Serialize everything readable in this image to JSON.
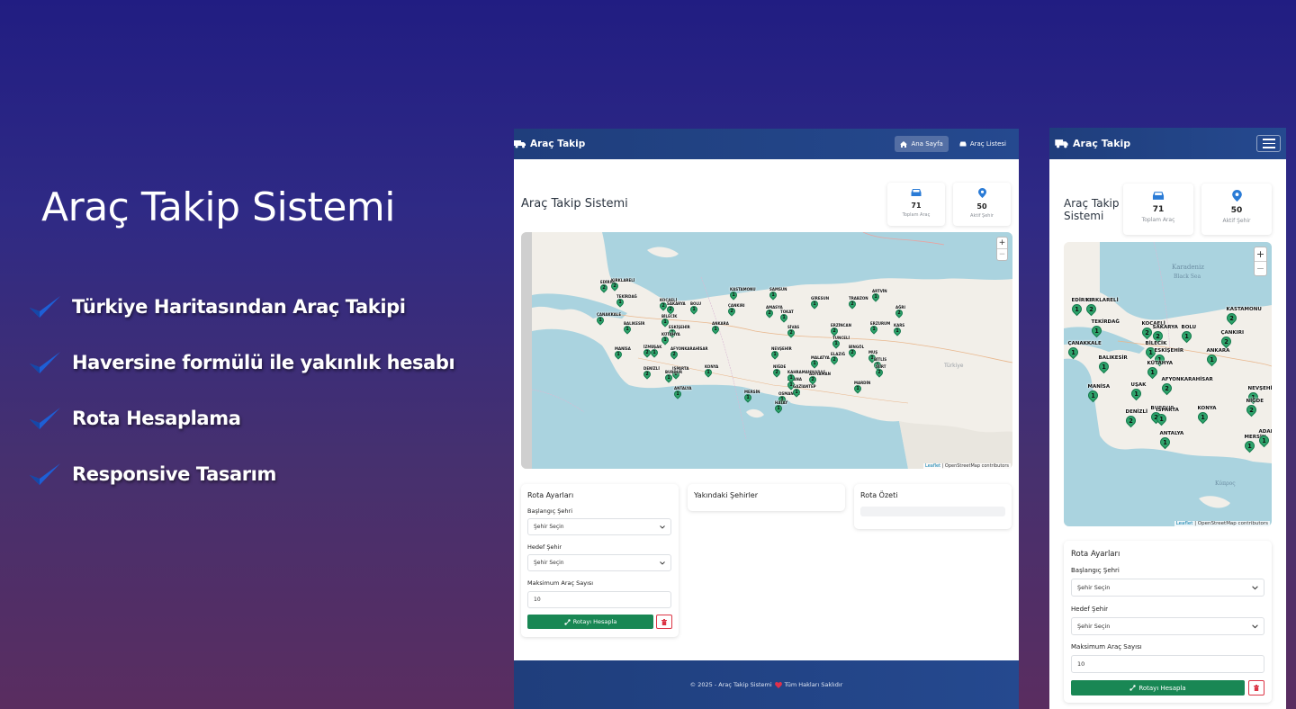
{
  "promo": {
    "title": "Araç Takip Sistemi",
    "features": [
      "Türkiye Haritasından Araç Takipi",
      "Haversine formülü ile yakınlık hesabı",
      "Rota Hesaplama",
      "Responsive Tasarım"
    ]
  },
  "app": {
    "brand": "Araç Takip",
    "nav": {
      "home": "Ana Sayfa",
      "list": "Araç Listesi"
    },
    "page_title": "Araç Takip Sistemi",
    "mobile_page_title_line1": "Araç Takip",
    "mobile_page_title_line2": "Sistemi",
    "stats": {
      "vehicles": {
        "value": "71",
        "label": "Toplam Araç"
      },
      "cities": {
        "value": "50",
        "label": "Aktif Şehir"
      }
    },
    "map": {
      "zoom_in": "+",
      "zoom_out": "−",
      "attribution_leaflet": "Leaflet",
      "attribution_osm": "| OpenStreetMap contributors",
      "sea_label": "Karadeniz",
      "sea_label2": "Black Sea"
    },
    "route": {
      "title": "Rota Ayarları",
      "start_label": "Başlangıç Şehri",
      "start_value": "Şehir Seçin",
      "target_label": "Hedef Şehir",
      "target_value": "Şehir Seçin",
      "max_label": "Maksimum Araç Sayısı",
      "max_value": "10",
      "calc_button": "Rotayı Hesapla"
    },
    "nearby_title": "Yakındaki Şehirler",
    "summary_title": "Rota Özeti",
    "footer_left": "© 2025 - Araç Takip Sistemi",
    "footer_right": "Tüm Hakları Saklıdır"
  },
  "desktop_cities": [
    {
      "n": "EDİRNE",
      "c": "2"
    },
    {
      "n": "KIRKLARELİ",
      "c": "2"
    },
    {
      "n": "TEKİRDAĞ",
      "c": "1"
    },
    {
      "n": "ÇANAKKALE",
      "c": "1"
    },
    {
      "n": "BALIKESİR",
      "c": "1"
    },
    {
      "n": "MANİSA",
      "c": "1"
    },
    {
      "n": "İZMİR",
      "c": "2"
    },
    {
      "n": "DENİZLİ",
      "c": "2"
    },
    {
      "n": "KOCAELİ",
      "c": "2"
    },
    {
      "n": "SAKARYA",
      "c": "2"
    },
    {
      "n": "BOLU",
      "c": "1"
    },
    {
      "n": "BİLECİK",
      "c": "1"
    },
    {
      "n": "ESKİŞEHİR",
      "c": "1"
    },
    {
      "n": "KÜTAHYA",
      "c": "1"
    },
    {
      "n": "UŞAK",
      "c": "1"
    },
    {
      "n": "AFYONKARAHİSAR",
      "c": "2"
    },
    {
      "n": "ISPARTA",
      "c": "2"
    },
    {
      "n": "BURDUR",
      "c": "1"
    },
    {
      "n": "ANTALYA",
      "c": "1"
    },
    {
      "n": "KONYA",
      "c": "1"
    },
    {
      "n": "ANKARA",
      "c": "1"
    },
    {
      "n": "KASTAMONU",
      "c": "1"
    },
    {
      "n": "ÇANKIRI",
      "c": "2"
    },
    {
      "n": "SAMSUN",
      "c": "1"
    },
    {
      "n": "AMASYA",
      "c": "2"
    },
    {
      "n": "TOKAT",
      "c": "1"
    },
    {
      "n": "SİVAS",
      "c": "2"
    },
    {
      "n": "NEVŞEHİR",
      "c": "1"
    },
    {
      "n": "NİĞDE",
      "c": "2"
    },
    {
      "n": "ADANA",
      "c": "1"
    },
    {
      "n": "MERSİN",
      "c": "1"
    },
    {
      "n": "OSMANİYE",
      "c": "1"
    },
    {
      "n": "HATAY",
      "c": "1"
    },
    {
      "n": "GAZİANTEP",
      "c": "1"
    },
    {
      "n": "KAHRAMANMARAŞ",
      "c": "1"
    },
    {
      "n": "ADIYAMAN",
      "c": "2"
    },
    {
      "n": "MALATYA",
      "c": "1"
    },
    {
      "n": "ELAZIĞ",
      "c": "2"
    },
    {
      "n": "TUNCELİ",
      "c": "1"
    },
    {
      "n": "BİNGÖL",
      "c": "2"
    },
    {
      "n": "MUŞ",
      "c": "1"
    },
    {
      "n": "BİTLİS",
      "c": "1"
    },
    {
      "n": "SİİRT",
      "c": "2"
    },
    {
      "n": "MARDİN",
      "c": "1"
    },
    {
      "n": "ERZİNCAN",
      "c": "2"
    },
    {
      "n": "ERZURUM",
      "c": "1"
    },
    {
      "n": "GİRESUN",
      "c": "1"
    },
    {
      "n": "TRABZON",
      "c": "2"
    },
    {
      "n": "ARTVİN",
      "c": "1"
    },
    {
      "n": "KARS",
      "c": "1"
    },
    {
      "n": "AĞRI",
      "c": "2"
    }
  ],
  "mobile_cities": [
    {
      "n": "EDİRNE",
      "c": "1"
    },
    {
      "n": "KIRKLARELİ",
      "c": "2"
    },
    {
      "n": "TEKİRDAĞ",
      "c": "1"
    },
    {
      "n": "ÇANAKKALE",
      "c": "1"
    },
    {
      "n": "BALIKESİR",
      "c": "1"
    },
    {
      "n": "MANİSA",
      "c": "1"
    },
    {
      "n": "UŞAK",
      "c": "1"
    },
    {
      "n": "DENİZLİ",
      "c": "2"
    },
    {
      "n": "BURDUR",
      "c": "2"
    },
    {
      "n": "ISPARTA",
      "c": "1"
    },
    {
      "n": "ANTALYA",
      "c": "1"
    },
    {
      "n": "KONYA",
      "c": "1"
    },
    {
      "n": "KOCAELİ",
      "c": "2"
    },
    {
      "n": "SAKARYA",
      "c": "2"
    },
    {
      "n": "BOLU",
      "c": "1"
    },
    {
      "n": "BİLECİK",
      "c": "1"
    },
    {
      "n": "ESKİŞEHİR",
      "c": "1"
    },
    {
      "n": "KÜTAHYA",
      "c": "1"
    },
    {
      "n": "AFYONKARAHİSAR",
      "c": "2"
    },
    {
      "n": "ANKARA",
      "c": "1"
    },
    {
      "n": "KASTAMONU",
      "c": "2"
    },
    {
      "n": "ÇANKIRI",
      "c": "2"
    },
    {
      "n": "NEVŞEHİR",
      "c": "1"
    },
    {
      "n": "NİĞDE",
      "c": "2"
    },
    {
      "n": "MERSİN",
      "c": "1"
    },
    {
      "n": "ADANA",
      "c": "1"
    }
  ],
  "colors": {
    "navbar": "#1f3e7c",
    "marker": "#2ea36b",
    "accent_blue": "#2a7bd6",
    "button_green": "#198754",
    "danger": "#dc3545"
  }
}
